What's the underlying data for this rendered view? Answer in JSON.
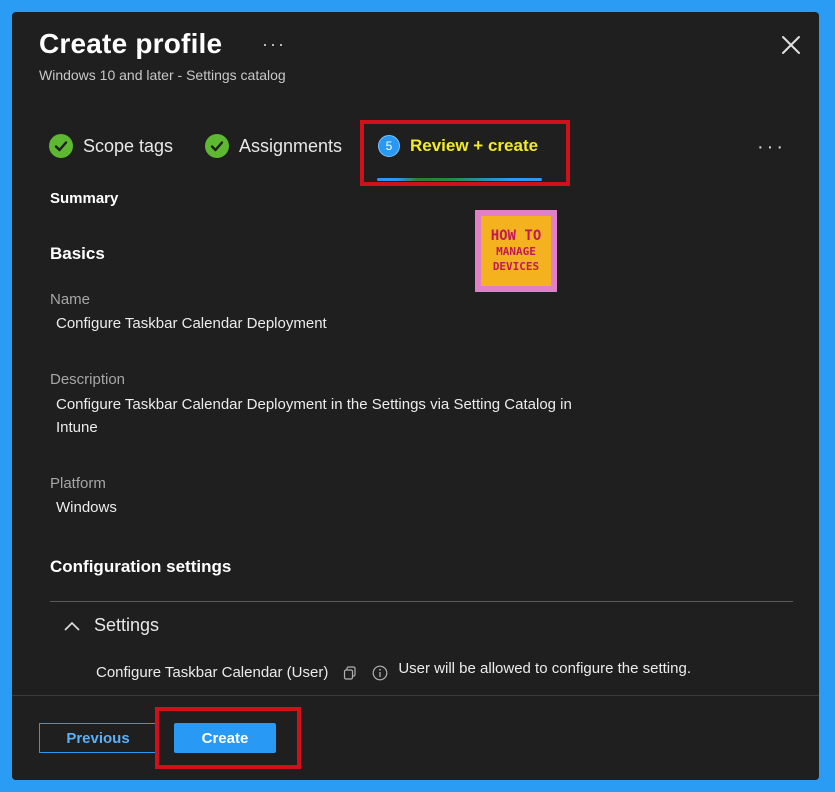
{
  "header": {
    "title": "Create profile",
    "more": "···",
    "subtitle": "Windows 10 and later - Settings catalog"
  },
  "wizard": {
    "steps": [
      {
        "label": "Scope tags",
        "state": "complete"
      },
      {
        "label": "Assignments",
        "state": "complete"
      },
      {
        "number": "5",
        "label": "Review + create",
        "state": "active"
      }
    ],
    "more": "···"
  },
  "summary": {
    "heading": "Summary",
    "basics_heading": "Basics",
    "fields": [
      {
        "label": "Name",
        "value": "Configure Taskbar Calendar Deployment"
      },
      {
        "label": "Description",
        "value_line1": "Configure Taskbar Calendar Deployment in the Settings via Setting Catalog in",
        "value_line2": "Intune"
      },
      {
        "label": "Platform",
        "value": "Windows"
      }
    ],
    "config_heading": "Configuration settings",
    "settings_toggle": "Settings",
    "setting": {
      "name": "Configure Taskbar Calendar (User)",
      "value": "User will be allowed to configure the setting."
    }
  },
  "logo": {
    "line1": "HOW TO",
    "line2": "MANAGE",
    "line3": "DEVICES"
  },
  "footer": {
    "previous_label": "Previous",
    "create_label": "Create"
  },
  "colors": {
    "accent": "#2899f5",
    "check": "#5fb832",
    "highlight": "#d0111b",
    "active_tab_text": "#f2ea2a"
  }
}
